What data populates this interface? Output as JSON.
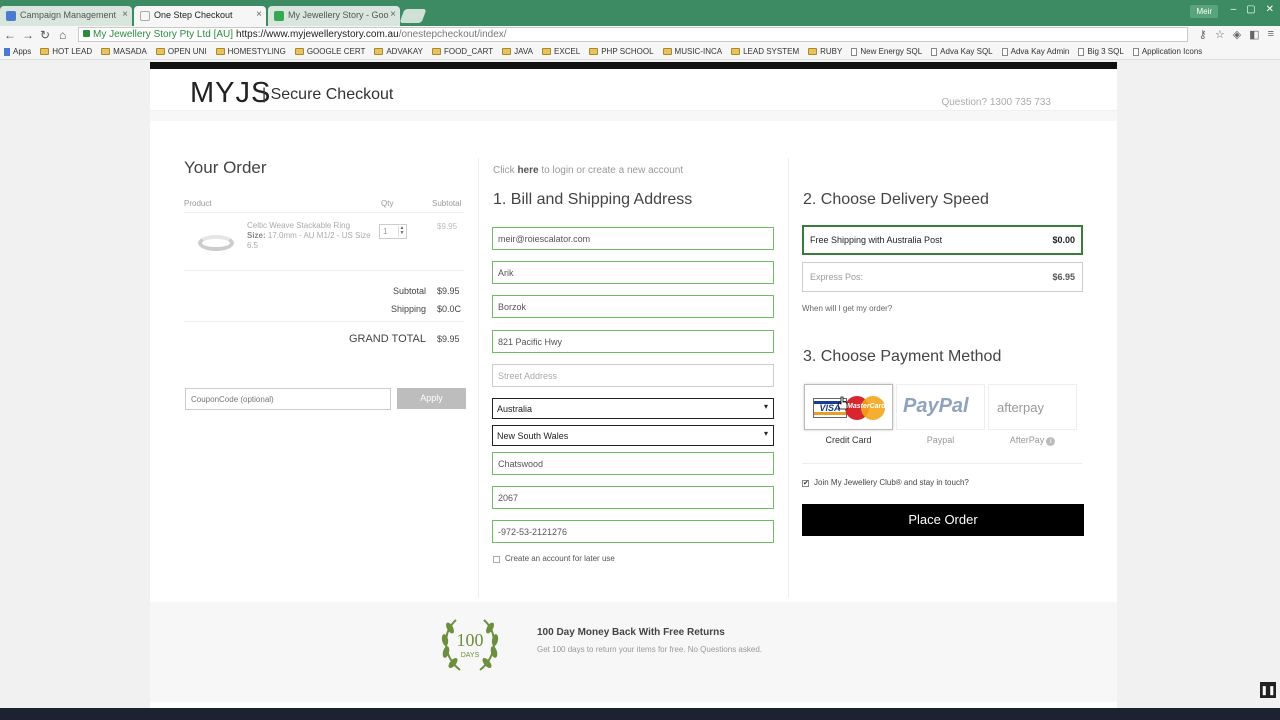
{
  "browser": {
    "tabs": [
      {
        "title": "Campaign Management",
        "favicon_color": "#4a7bd0"
      },
      {
        "title": "One Step Checkout",
        "favicon_color": "#ffffff"
      },
      {
        "title": "My Jewellery Story - Goo",
        "favicon_color": "#34a853"
      }
    ],
    "user_chip": "Meir",
    "ev_label": "My Jewellery Story Pty Ltd [AU]",
    "url_host": "https://www.myjewellerystory.com.au",
    "url_path": "/onestepcheckout/index/",
    "bookmarks": [
      {
        "label": "Apps",
        "type": "apps"
      },
      {
        "label": "HOT LEAD",
        "type": "folder"
      },
      {
        "label": "MASADA",
        "type": "folder"
      },
      {
        "label": "OPEN UNI",
        "type": "folder"
      },
      {
        "label": "HOMESTYLING",
        "type": "folder"
      },
      {
        "label": "GOOGLE CERT",
        "type": "folder"
      },
      {
        "label": "ADVAKAY",
        "type": "folder"
      },
      {
        "label": "FOOD_CART",
        "type": "folder"
      },
      {
        "label": "JAVA",
        "type": "folder"
      },
      {
        "label": "EXCEL",
        "type": "folder"
      },
      {
        "label": "PHP SCHOOL",
        "type": "folder"
      },
      {
        "label": "MUSIC-INCA",
        "type": "folder"
      },
      {
        "label": "LEAD SYSTEM",
        "type": "folder"
      },
      {
        "label": "RUBY",
        "type": "folder"
      },
      {
        "label": "New Energy SQL",
        "type": "page"
      },
      {
        "label": "Adva Kay SQL",
        "type": "page"
      },
      {
        "label": "Adva Kay Admin",
        "type": "page"
      },
      {
        "label": "Big 3 SQL",
        "type": "page"
      },
      {
        "label": "Application Icons",
        "type": "page"
      }
    ]
  },
  "header": {
    "logo": "MYJS",
    "title": "| Secure Checkout",
    "question": "Question? 1300 735 733"
  },
  "order": {
    "heading": "Your Order",
    "col_product": "Product",
    "col_qty": "Qty",
    "col_subtotal": "Subtotal",
    "item": {
      "name": "Celtic Weave Stackable Ring",
      "size_label": "Size:",
      "size_value": "17.0mm - AU M1/2 - US Size 6.5",
      "qty": "1",
      "price": "$9.95"
    },
    "subtotal_label": "Subtotal",
    "subtotal_value": "$9.95",
    "shipping_label": "Shipping",
    "shipping_value": "$0.0C",
    "grand_label": "GRAND TOTAL",
    "grand_value": "$9.95",
    "coupon_placeholder": "CouponCode (optional)",
    "apply_label": "Apply"
  },
  "address": {
    "login_pre": "Click",
    "login_link": "here",
    "login_post": "to login or create a new account",
    "heading": "1. Bill and Shipping Address",
    "email": "meir@roiescalator.com",
    "first_name": "Arik",
    "last_name": "Borzok",
    "street1": "821 Pacific Hwy",
    "street2_placeholder": "Street Address",
    "country": "Australia",
    "state": "New South Wales",
    "city": "Chatswood",
    "postcode": "2067",
    "phone": "-972-53-2121276",
    "create_account": "Create an account for later use"
  },
  "delivery": {
    "heading": "2. Choose Delivery Speed",
    "options": [
      {
        "label": "Free Shipping with Australia Post",
        "price": "$0.00",
        "selected": true
      },
      {
        "label": "Express Pos:",
        "price": "$6.95",
        "selected": false
      }
    ],
    "when_link": "When will I get my order?"
  },
  "payment": {
    "heading": "3. Choose Payment Method",
    "credit_label": "Credit Card",
    "visa_text": "VISA",
    "mastercard_text": "MasterCard",
    "paypal_logo": "PayPal",
    "paypal_label": "Paypal",
    "afterpay_logo": "afterpay",
    "afterpay_label": "AfterPay",
    "info_glyph": "i",
    "club_check": "✔",
    "club_label": "Join My Jewellery Club® and stay in touch?",
    "place_order": "Place Order"
  },
  "footer": {
    "badge_number": "100",
    "badge_word": "DAYS",
    "title": "100 Day Money Back With Free Returns",
    "subtitle": "Get 100 days to return your items for free. No Questions asked."
  },
  "colors": {
    "chrome": "#3c8b63",
    "field_valid": "#6cbf5f",
    "selected_delivery": "#3a7d3a",
    "button": "#000000"
  }
}
